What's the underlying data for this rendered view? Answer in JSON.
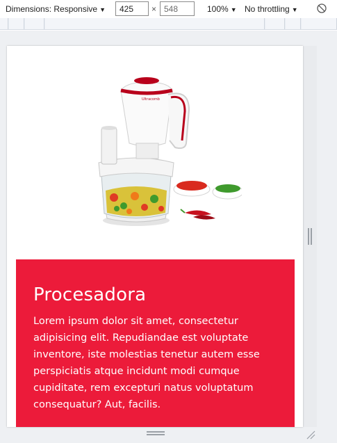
{
  "devtools": {
    "dimensions_label": "Dimensions: Responsive",
    "width_value": "425",
    "height_value": "548",
    "times_symbol": "×",
    "zoom_label": "100%",
    "throttle_label": "No throttling",
    "caret": "▼"
  },
  "page": {
    "product_image_icon": "food-processor-image",
    "card": {
      "title": "Procesadora",
      "text": "Lorem ipsum dolor sit amet, consectetur adipisicing elit. Repudiandae est voluptate inventore, iste molestias tenetur autem esse perspiciatis atque incidunt modi cumque cupiditate, rem excepturi natus voluptatum consequatur? Aut, facilis.",
      "background_color": "#ec1b3a"
    }
  }
}
